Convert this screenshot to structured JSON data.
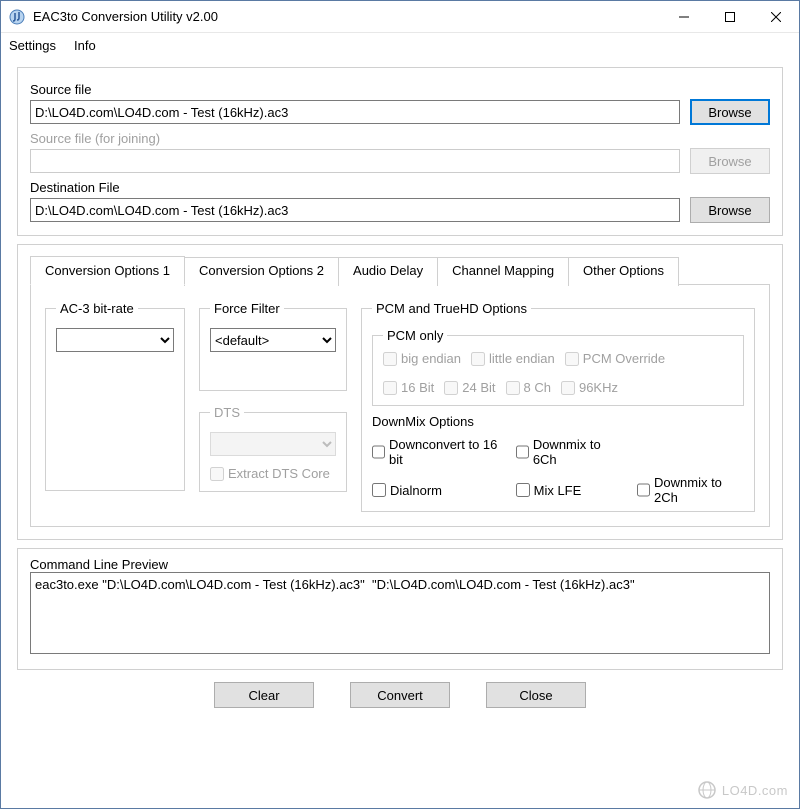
{
  "window": {
    "title": "EAC3to Conversion Utility   v2.00"
  },
  "menu": {
    "settings": "Settings",
    "info": "Info"
  },
  "files": {
    "source_label": "Source file",
    "source_value": "D:\\LO4D.com\\LO4D.com - Test (16kHz).ac3",
    "source_browse": "Browse",
    "join_label": "Source file (for joining)",
    "join_value": "",
    "join_browse": "Browse",
    "dest_label": "Destination File",
    "dest_value": "D:\\LO4D.com\\LO4D.com - Test (16kHz).ac3",
    "dest_browse": "Browse"
  },
  "tabs": {
    "t1": "Conversion Options 1",
    "t2": "Conversion Options 2",
    "t3": "Audio Delay",
    "t4": "Channel Mapping",
    "t5": "Other Options"
  },
  "opts": {
    "ac3_legend": "AC-3 bit-rate",
    "ac3_value": "",
    "force_legend": "Force Filter",
    "force_value": "<default>",
    "dts_legend": "DTS",
    "dts_extract": "Extract DTS Core",
    "pcm_legend": "PCM and TrueHD Options",
    "pcm_only_legend": "PCM only",
    "big_endian": "big endian",
    "little_endian": "little endian",
    "pcm_override": "PCM Override",
    "b16": "16 Bit",
    "b24": "24 Bit",
    "ch8": "8 Ch",
    "k96": "96KHz",
    "downmix_legend": "DownMix Options",
    "downconvert16": "Downconvert to 16 bit",
    "down6ch": "Downmix to 6Ch",
    "dialnorm": "Dialnorm",
    "mixlfe": "Mix LFE",
    "down2ch": "Downmix to 2Ch"
  },
  "cmd": {
    "label": "Command Line Preview",
    "text": "eac3to.exe \"D:\\LO4D.com\\LO4D.com - Test (16kHz).ac3\"  \"D:\\LO4D.com\\LO4D.com - Test (16kHz).ac3\""
  },
  "buttons": {
    "clear": "Clear",
    "convert": "Convert",
    "close": "Close"
  },
  "watermark": "LO4D.com"
}
